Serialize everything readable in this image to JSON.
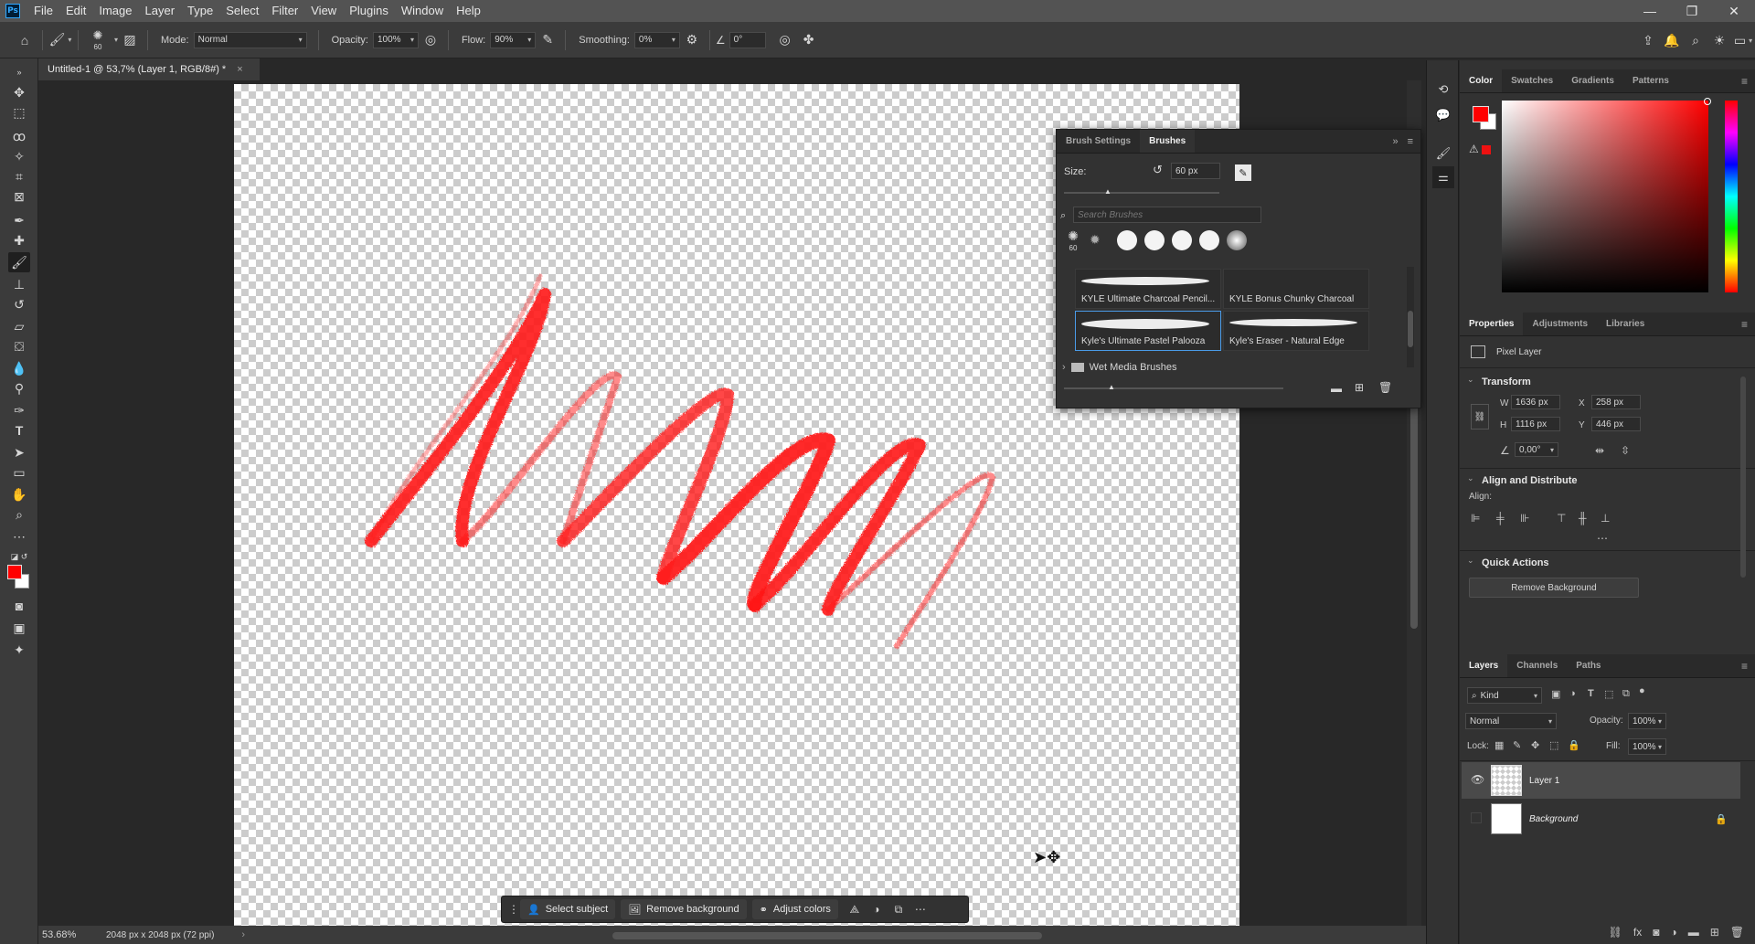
{
  "menu": {
    "items": [
      "File",
      "Edit",
      "Image",
      "Layer",
      "Type",
      "Select",
      "Filter",
      "View",
      "Plugins",
      "Window",
      "Help"
    ]
  },
  "options": {
    "brush_size": "60",
    "mode_label": "Mode:",
    "mode_value": "Normal",
    "opacity_label": "Opacity:",
    "opacity_value": "100%",
    "flow_label": "Flow:",
    "flow_value": "90%",
    "smoothing_label": "Smoothing:",
    "smoothing_value": "0%",
    "angle_value": "0°"
  },
  "document": {
    "tab_title": "Untitled-1 @ 53,7% (Layer 1, RGB/8#) *",
    "close": "×"
  },
  "status": {
    "zoom": "53.68%",
    "doc_info": "2048 px x 2048 px (72 ppi)"
  },
  "taskbar": {
    "select_subject": "Select subject",
    "remove_background": "Remove background",
    "adjust_colors": "Adjust colors"
  },
  "brushes_panel": {
    "tabs": [
      "Brush Settings",
      "Brushes"
    ],
    "size_label": "Size:",
    "size_value": "60 px",
    "search_placeholder": "Search Brushes",
    "preset_size": "60",
    "brushes": [
      "KYLE Ultimate Charcoal Pencil...",
      "KYLE Bonus Chunky Charcoal",
      "Kyle's Ultimate Pastel Palooza",
      "Kyle's Eraser - Natural Edge"
    ],
    "group": "Wet Media Brushes"
  },
  "color_panel": {
    "tabs": [
      "Color",
      "Swatches",
      "Gradients",
      "Patterns"
    ],
    "foreground": "#ff0000",
    "background": "#ffffff"
  },
  "properties_panel": {
    "tabs": [
      "Properties",
      "Adjustments",
      "Libraries"
    ],
    "layer_type": "Pixel Layer",
    "transform_title": "Transform",
    "w_label": "W",
    "w_value": "1636 px",
    "h_label": "H",
    "h_value": "1116 px",
    "x_label": "X",
    "x_value": "258 px",
    "y_label": "Y",
    "y_value": "446 px",
    "angle_value": "0,00°",
    "align_title": "Align and Distribute",
    "align_label": "Align:",
    "quick_title": "Quick Actions",
    "remove_bg_button": "Remove Background"
  },
  "layers_panel": {
    "tabs": [
      "Layers",
      "Channels",
      "Paths"
    ],
    "filter_kind": "Kind",
    "blend_mode": "Normal",
    "opacity_label": "Opacity:",
    "opacity_value": "100%",
    "lock_label": "Lock:",
    "fill_label": "Fill:",
    "fill_value": "100%",
    "layers": [
      "Layer 1",
      "Background"
    ]
  },
  "colors": {
    "stroke_red": "#ff1a1a",
    "panel_bg": "#323232",
    "selection_blue": "#4a9be8"
  }
}
